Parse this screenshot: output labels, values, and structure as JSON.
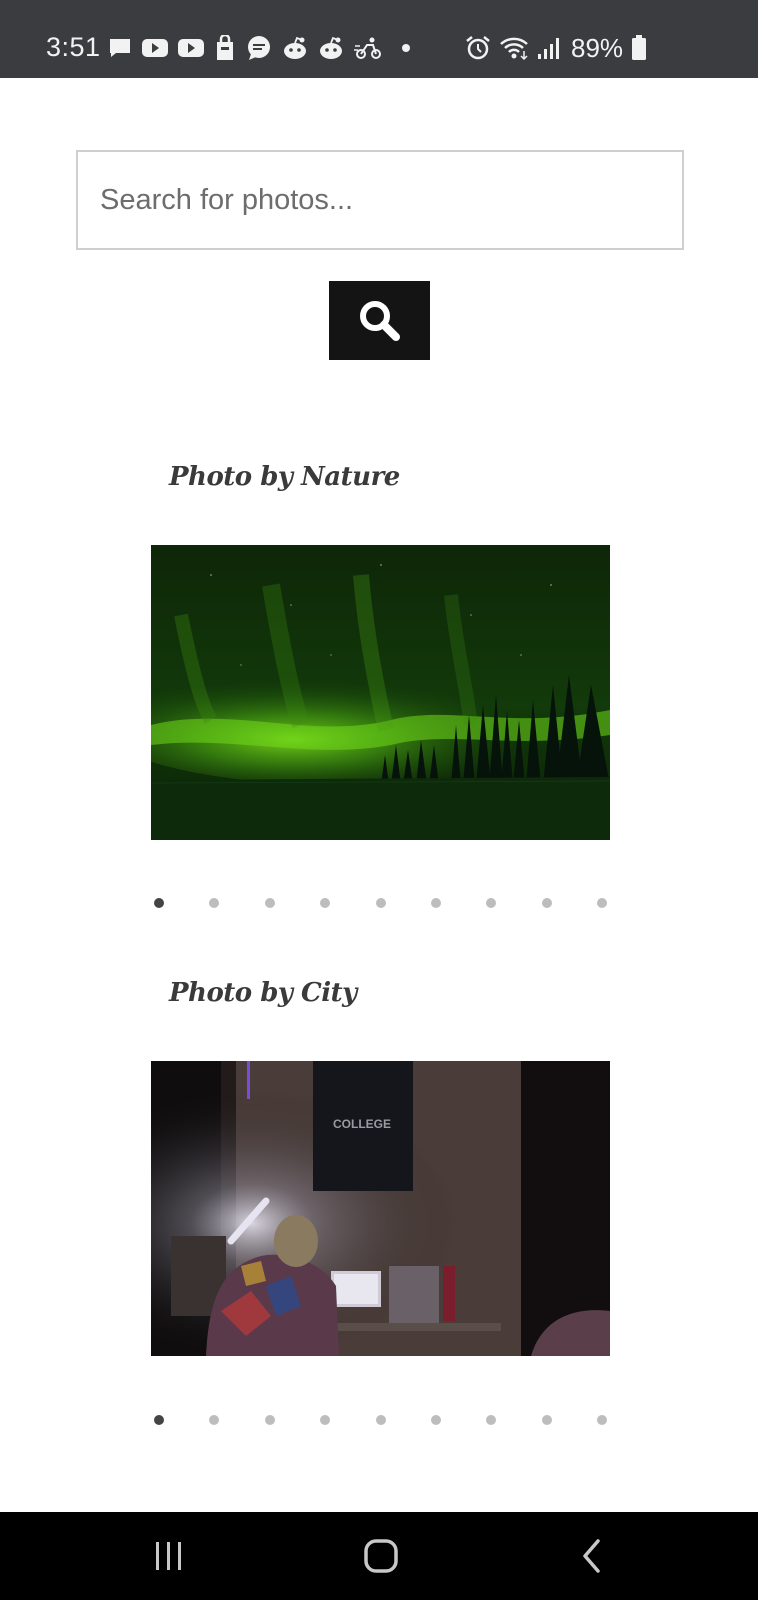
{
  "status_bar": {
    "time": "3:51",
    "battery": "89%",
    "notification_icons": [
      "message-icon",
      "youtube-icon",
      "youtube-icon",
      "shopping-bag-icon",
      "chat-bubble-icon",
      "reddit-icon",
      "reddit-icon",
      "delivery-icon",
      "dot-icon"
    ],
    "system_icons": [
      "alarm-icon",
      "wifi-icon",
      "signal-icon",
      "battery-icon"
    ]
  },
  "search": {
    "placeholder": "Search for photos...",
    "value": "",
    "button_icon": "search-icon"
  },
  "sections": [
    {
      "title": "Photo by Nature",
      "photo_subject": "aurora over forest",
      "dots_total": 9,
      "active_dot": 1
    },
    {
      "title": "Photo by City",
      "photo_subject": "person at desk in dark room",
      "photo_text": "COLLEGE",
      "dots_total": 9,
      "active_dot": 1
    }
  ],
  "nav_bar": {
    "buttons": [
      "recent-apps-icon",
      "home-icon",
      "back-icon"
    ]
  },
  "colors": {
    "status_bar_bg": "#3b3c3f",
    "button_bg": "#141414",
    "dot_active": "#444444",
    "dot_inactive": "#bdbdbd",
    "nav_bar_bg": "#000000"
  }
}
